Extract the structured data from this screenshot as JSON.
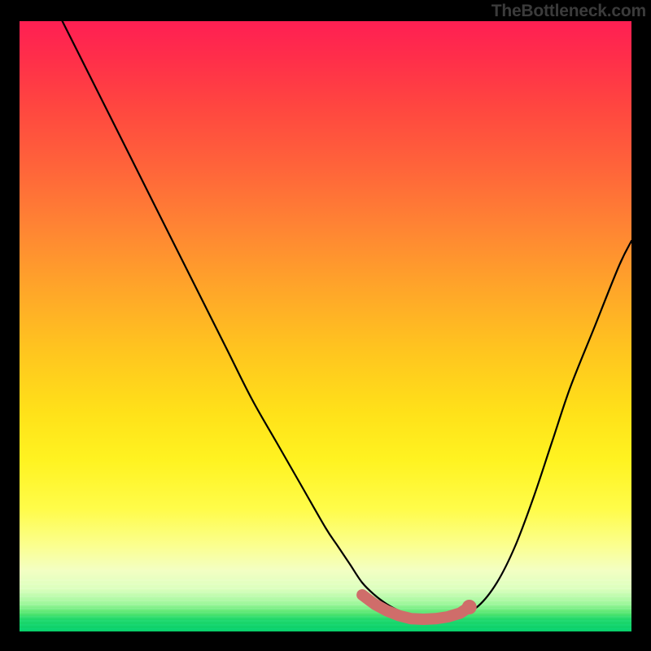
{
  "watermark": "TheBottleneck.com",
  "colors": {
    "frame": "#000000",
    "gradient_top": "#ff1f53",
    "gradient_mid": "#ffe119",
    "gradient_bottom": "#08cf6a",
    "curve_stroke": "#000000",
    "marker_stroke": "#cf6d6a",
    "marker_fill": "#cf6d6a"
  },
  "chart_data": {
    "type": "line",
    "title": "",
    "xlabel": "",
    "ylabel": "",
    "xlim": [
      0,
      100
    ],
    "ylim": [
      0,
      100
    ],
    "series": [
      {
        "name": "bottleneck-curve",
        "x": [
          7,
          10,
          14,
          18,
          22,
          26,
          30,
          34,
          38,
          42,
          46,
          50,
          52,
          54,
          56,
          58,
          60,
          62,
          64,
          66,
          68,
          70,
          72,
          75,
          78,
          81,
          84,
          87,
          90,
          94,
          98,
          100
        ],
        "y": [
          100,
          94,
          86,
          78,
          70,
          62,
          54,
          46,
          38,
          31,
          24,
          17,
          14,
          11,
          8,
          6,
          4.5,
          3.4,
          2.6,
          2.1,
          2.0,
          2.1,
          2.6,
          4.2,
          8,
          14,
          22,
          31,
          40,
          50,
          60,
          64
        ]
      }
    ],
    "markers": {
      "name": "optimal-range",
      "x": [
        56,
        58,
        60,
        62,
        64,
        66,
        68,
        70,
        72,
        73.5
      ],
      "y": [
        6.0,
        4.5,
        3.4,
        2.6,
        2.1,
        2.0,
        2.1,
        2.4,
        3.0,
        4.0
      ]
    }
  }
}
